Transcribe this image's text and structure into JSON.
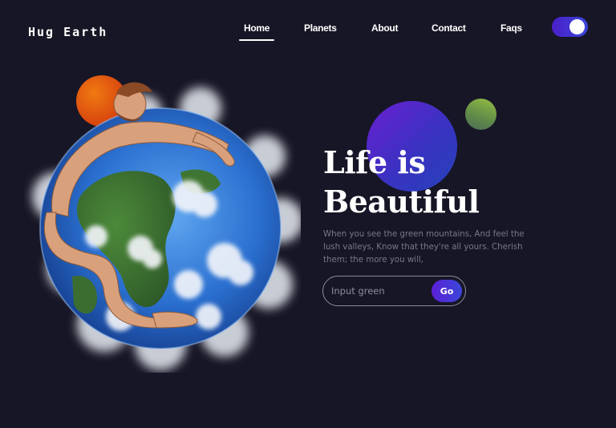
{
  "brand": {
    "name": "Hug Earth"
  },
  "nav": {
    "items": [
      {
        "label": "Home",
        "active": true
      },
      {
        "label": "Planets",
        "active": false
      },
      {
        "label": "About",
        "active": false
      },
      {
        "label": "Contact",
        "active": false
      },
      {
        "label": "Faqs",
        "active": false
      }
    ],
    "theme_toggle": {
      "on": true
    }
  },
  "hero": {
    "title_line1": "Life is",
    "title_line2": "Beautiful",
    "description": "When you see the green mountains, And feel the lush valleys, Know that they're all yours. Cherish them; the more you will,",
    "input": {
      "placeholder": "Input green",
      "value": ""
    },
    "button_label": "Go"
  },
  "colors": {
    "background": "#171626",
    "accent_purple": "#5b21d6",
    "accent_blue": "#3a46d9",
    "orb_orange": "#e0540f",
    "orb_green": "#7aa24a"
  }
}
